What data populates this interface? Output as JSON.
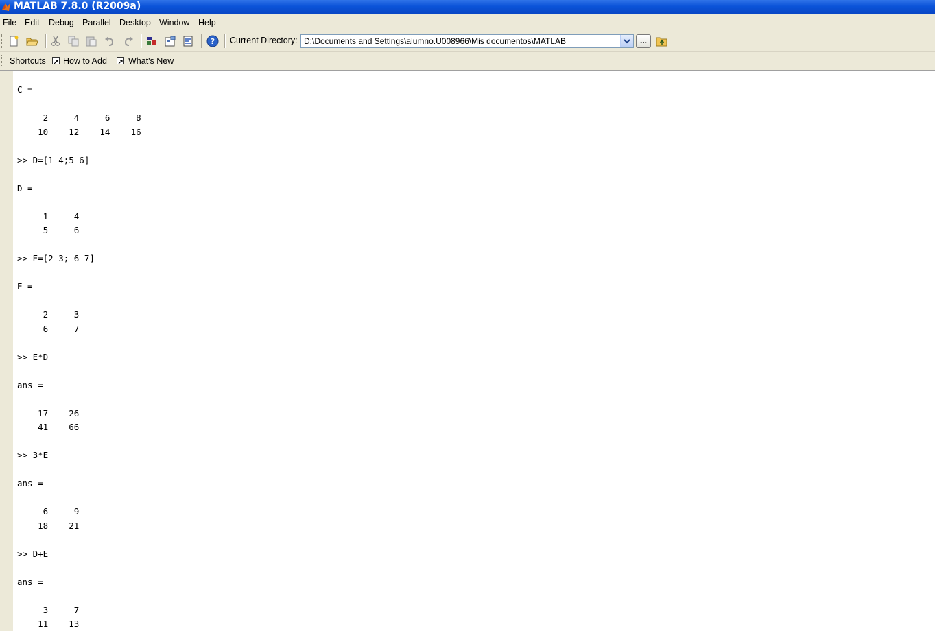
{
  "window": {
    "title": "MATLAB  7.8.0 (R2009a)"
  },
  "menu": [
    "File",
    "Edit",
    "Debug",
    "Parallel",
    "Desktop",
    "Window",
    "Help"
  ],
  "toolbar": {
    "buttons": [
      "new-file-icon",
      "open-folder-icon",
      "cut-icon",
      "copy-icon",
      "paste-icon",
      "undo-icon",
      "redo-icon",
      "simulink-icon",
      "guide-icon",
      "profiler-icon",
      "help-icon"
    ],
    "current_directory_label": "Current Directory:",
    "current_directory_value": "D:\\Documents and Settings\\alumno.U008966\\Mis documentos\\MATLAB",
    "browse_label": "..."
  },
  "shortcuts": {
    "label": "Shortcuts",
    "items": [
      "How to Add",
      "What's New"
    ]
  },
  "command_window": {
    "lines": [
      "C =",
      "",
      "     2     4     6     8",
      "    10    12    14    16",
      "",
      ">> D=[1 4;5 6]",
      "",
      "D =",
      "",
      "     1     4",
      "     5     6",
      "",
      ">> E=[2 3; 6 7]",
      "",
      "E =",
      "",
      "     2     3",
      "     6     7",
      "",
      ">> E*D",
      "",
      "ans =",
      "",
      "    17    26",
      "    41    66",
      "",
      ">> 3*E",
      "",
      "ans =",
      "",
      "     6     9",
      "    18    21",
      "",
      ">> D+E",
      "",
      "ans =",
      "",
      "     3     7",
      "    11    13"
    ]
  }
}
